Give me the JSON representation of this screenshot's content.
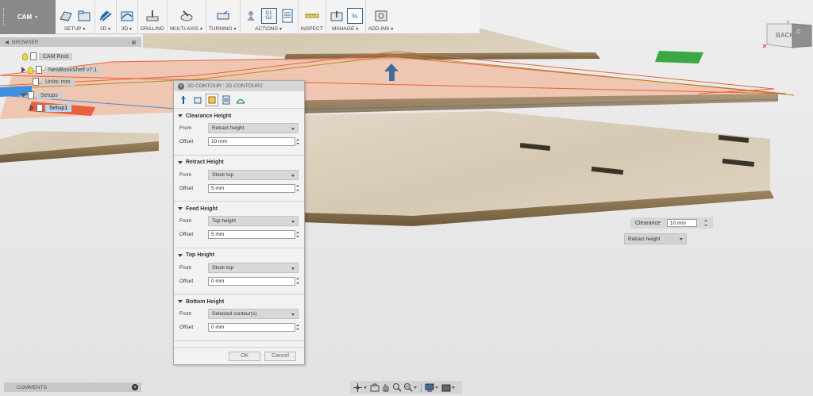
{
  "toolbar": {
    "workspace": "CAM",
    "groups": [
      {
        "label": "SETUP",
        "dropdown": true,
        "icons": [
          "new-setup-icon",
          "setup-folder-icon"
        ]
      },
      {
        "label": "2D",
        "dropdown": true,
        "icons": [
          "2d-toolpath-icon"
        ]
      },
      {
        "label": "3D",
        "dropdown": true,
        "icons": [
          "3d-toolpath-icon"
        ]
      },
      {
        "label": "DRILLING",
        "dropdown": false,
        "icons": [
          "drill-icon"
        ]
      },
      {
        "label": "MULTI-AXIS",
        "dropdown": true,
        "icons": [
          "multi-axis-icon"
        ]
      },
      {
        "label": "TURNING",
        "dropdown": true,
        "icons": [
          "turning-icon"
        ]
      },
      {
        "label": "ACTIONS",
        "dropdown": true,
        "icons": [
          "simulate-icon",
          "g1g2-post-icon",
          "setup-sheet-icon"
        ]
      },
      {
        "label": "INSPECT",
        "dropdown": false,
        "icons": [
          "measure-icon"
        ]
      },
      {
        "label": "MANAGE",
        "dropdown": true,
        "icons": [
          "tool-library-icon",
          "template-icon"
        ]
      },
      {
        "label": "ADD-INS",
        "dropdown": true,
        "icons": [
          "scripts-icon"
        ]
      }
    ],
    "g1g2_text": [
      "G1",
      "G2"
    ],
    "percent_glyph": "%"
  },
  "browser": {
    "title": "BROWSER",
    "items": [
      {
        "label": "CAM Root"
      },
      {
        "label": "NewBookShelf v7:1"
      },
      {
        "label": "Units: mm"
      },
      {
        "label": "Setups"
      },
      {
        "label": "Setup1"
      }
    ]
  },
  "viewcube": {
    "face_label": "BACK"
  },
  "dialog": {
    "title": "2D CONTOUR : 2D CONTOUR2",
    "tabs": [
      "tool-tab",
      "geometry-tab",
      "heights-tab",
      "passes-tab",
      "linking-tab"
    ],
    "active_tab": 2,
    "sections": [
      {
        "title": "Clearance Height",
        "from_label": "From",
        "from": "Retract height",
        "offset_label": "Offset",
        "offset": "10 mm"
      },
      {
        "title": "Retract Height",
        "from_label": "From",
        "from": "Stock top",
        "offset_label": "Offset",
        "offset": "5 mm"
      },
      {
        "title": "Feed Height",
        "from_label": "From",
        "from": "Top height",
        "offset_label": "Offset",
        "offset": "5 mm"
      },
      {
        "title": "Top Height",
        "from_label": "From",
        "from": "Stock top",
        "offset_label": "Offset",
        "offset": "0 mm"
      },
      {
        "title": "Bottom Height",
        "from_label": "From",
        "from": "Selected contour(s)",
        "offset_label": "Offset",
        "offset": "0 mm"
      }
    ],
    "ok_label": "OK",
    "cancel_label": "Cancel"
  },
  "manipulator": {
    "label": "Clearance",
    "value": "10 mm",
    "from": "Retract height"
  },
  "comments": {
    "title": "COMMENTS"
  },
  "colors": {
    "toolbar_bg": "#f3f3f3",
    "workspace_bg": "#8a8a8a",
    "selection_red": "#e8613c",
    "setup_blue": "#3f8fe0",
    "stock_green": "#39a845",
    "wood": "#d8ccb8",
    "wood_edge": "#8b7554"
  }
}
